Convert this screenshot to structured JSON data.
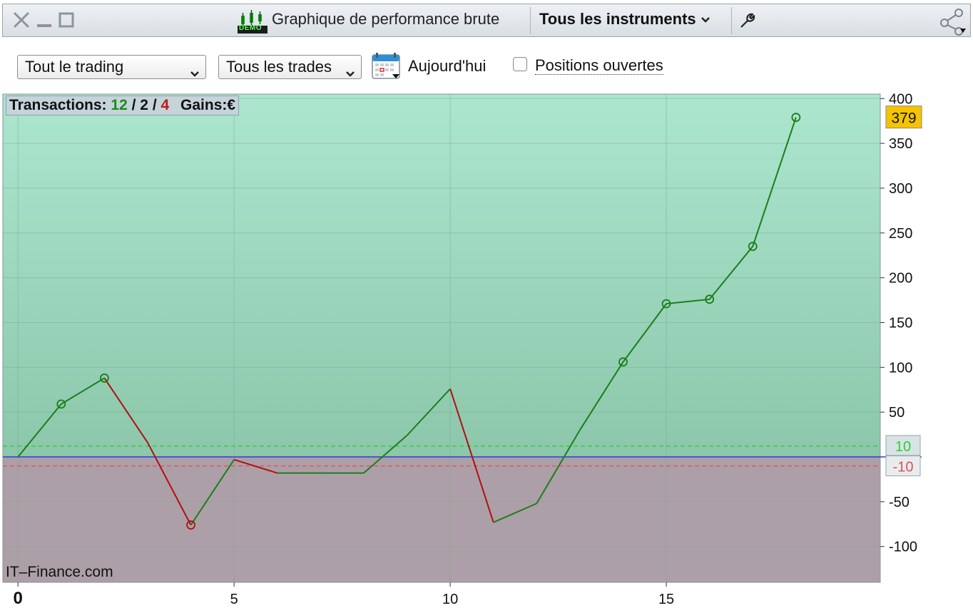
{
  "window": {
    "title": "Graphique de performance brute",
    "instrument_selector": "Tous les instruments",
    "demo_badge": "DEMO"
  },
  "toolbar": {
    "trading_select": "Tout le trading",
    "trades_select": "Tous les trades",
    "date_label": "Aujourd'hui",
    "open_positions_label": "Positions ouvertes",
    "open_positions_checked": false
  },
  "summary": {
    "transactions_label": "Transactions:",
    "total": "12",
    "sep1": "/",
    "mid": "2",
    "sep2": "/",
    "losses": "4",
    "gains_label": "Gains:",
    "currency": "€"
  },
  "watermark": "IT–Finance.com",
  "colors": {
    "profit_zone": "#9ed8bd",
    "loss_zone": "#ad9fa7",
    "gain_line": "#1a7f1a",
    "loss_line": "#b01010",
    "zero_line": "#2b3fd6",
    "upper_threshold": "#33cc33",
    "lower_threshold": "#e05050",
    "last_value_badge": "#f5c400"
  },
  "chart_data": {
    "type": "line",
    "x_ticks": [
      "0",
      "5",
      "10",
      "15"
    ],
    "y_ticks": [
      "400",
      "350",
      "300",
      "250",
      "200",
      "150",
      "100",
      "50",
      "-50",
      "-100"
    ],
    "ylim": [
      -140,
      405
    ],
    "xlim": [
      -0.35,
      19.95
    ],
    "grid": true,
    "points": [
      {
        "x": 0,
        "y": 0,
        "marker": false
      },
      {
        "x": 1,
        "y": 59,
        "marker": true
      },
      {
        "x": 2,
        "y": 88,
        "marker": true
      },
      {
        "x": 3,
        "y": 16,
        "marker": false
      },
      {
        "x": 4,
        "y": -76,
        "marker": true
      },
      {
        "x": 5,
        "y": -3,
        "marker": false
      },
      {
        "x": 6,
        "y": -18,
        "marker": false
      },
      {
        "x": 7,
        "y": -18,
        "marker": false
      },
      {
        "x": 8,
        "y": -18,
        "marker": false
      },
      {
        "x": 9,
        "y": 24,
        "marker": false
      },
      {
        "x": 10,
        "y": 76,
        "marker": false
      },
      {
        "x": 11,
        "y": -73,
        "marker": false
      },
      {
        "x": 12,
        "y": -52,
        "marker": false
      },
      {
        "x": 13,
        "y": 30,
        "marker": false
      },
      {
        "x": 14,
        "y": 106,
        "marker": true
      },
      {
        "x": 15,
        "y": 171,
        "marker": true
      },
      {
        "x": 16,
        "y": 176,
        "marker": true
      },
      {
        "x": 17,
        "y": 235,
        "marker": true
      },
      {
        "x": 18,
        "y": 379,
        "marker": true
      }
    ],
    "last_value": "379",
    "upper_threshold": 12,
    "lower_threshold": -10,
    "upper_threshold_label": "10",
    "lower_threshold_label": "-10"
  }
}
